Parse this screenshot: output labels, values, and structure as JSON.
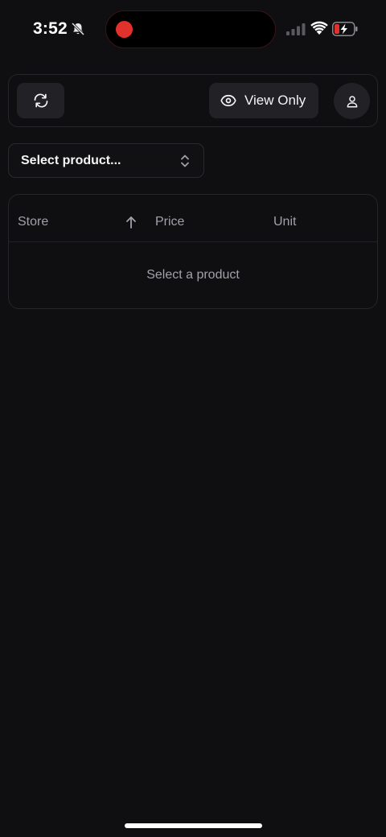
{
  "status_bar": {
    "time": "3:52",
    "bell_icon": "bell-muted-icon",
    "recording_color": "#e0312c",
    "battery_color": "#e0312c"
  },
  "toolbar": {
    "refresh_icon": "refresh-icon",
    "view_only_icon": "eye-icon",
    "view_only_label": "View Only",
    "profile_icon": "user-icon"
  },
  "product_select": {
    "label": "Select product...",
    "icon": "chevrons-up-down-icon"
  },
  "table": {
    "columns": [
      "Store",
      "Price",
      "Unit"
    ],
    "sort_icon": "arrow-up-icon",
    "empty_message": "Select a product"
  },
  "colors": {
    "background": "#0f0e10",
    "surface": "#222125",
    "border": "#26252a",
    "muted_text": "#a1a1aa"
  }
}
